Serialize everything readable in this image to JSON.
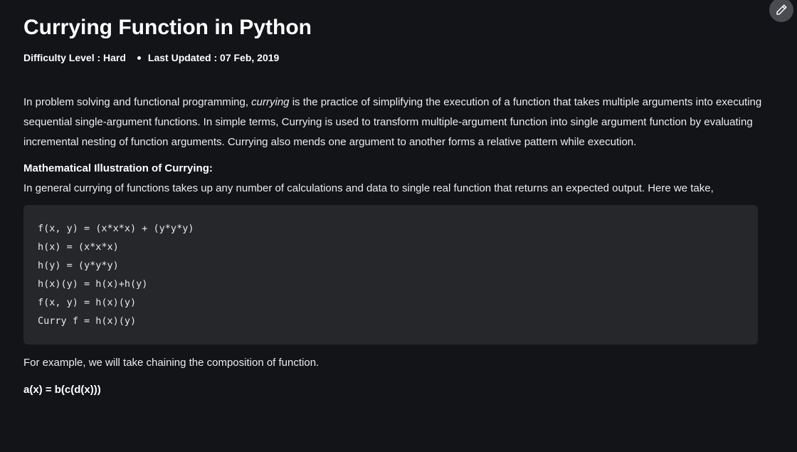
{
  "article": {
    "title": "Currying Function in Python",
    "difficulty": "Difficulty Level : Hard",
    "last_updated": "Last Updated : 07 Feb, 2019",
    "intro_before": "In problem solving and functional programming, ",
    "intro_italic": "currying",
    "intro_after": " is the practice of simplifying the execution of a function that takes multiple arguments into executing sequential single-argument functions. In simple terms, Currying is used to transform multiple-argument function into single argument function by evaluating incremental nesting of function arguments. Currying also mends one argument to another forms a relative pattern while execution.",
    "subheading": "Mathematical Illustration of Currying:",
    "general_text": "In general currying of functions takes up any number of calculations and data to single real function that returns an expected output. Here we take,",
    "code_lines": [
      "f(x, y) = (x*x*x) + (y*y*y)",
      "h(x) = (x*x*x)",
      "h(y) = (y*y*y)",
      "h(x)(y) = h(x)+h(y)",
      "f(x, y) = h(x)(y)",
      "Curry f = h(x)(y)"
    ],
    "example_text": "For example, we will take chaining the composition of function.",
    "formula": "a(x) = b(c(d(x)))"
  },
  "toolbar": {
    "edit_icon": "pencil-icon"
  },
  "colors": {
    "background": "#131417",
    "code_background": "#26272b",
    "text": "#ececec",
    "edit_button": "#4a4b50"
  }
}
